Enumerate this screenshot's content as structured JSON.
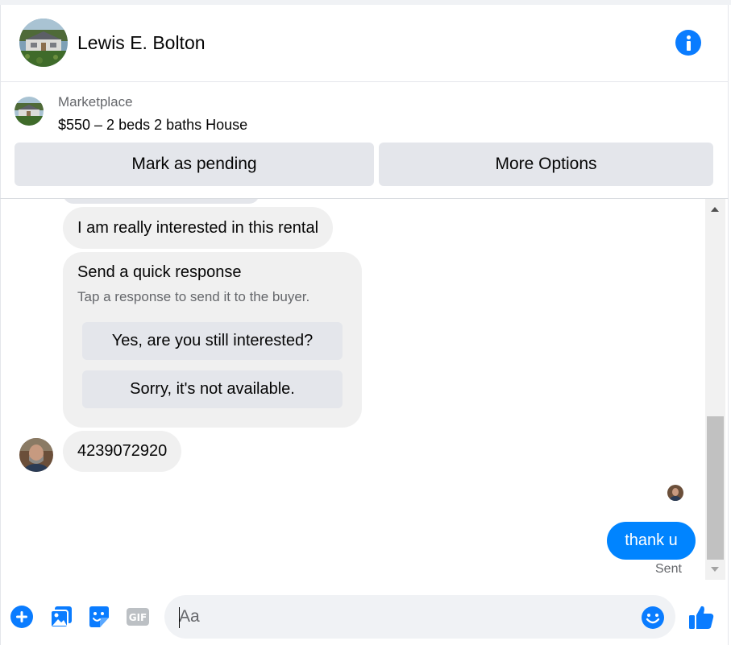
{
  "header": {
    "contact_name": "Lewis E. Bolton",
    "avatar_icon": "house-photo-icon",
    "info_icon": "info-icon"
  },
  "listing": {
    "source": "Marketplace",
    "title": "$550 – 2 beds 2 baths House",
    "thumbnail_icon": "house-photo-icon",
    "actions": {
      "mark_pending": "Mark as pending",
      "more_options": "More Options"
    }
  },
  "messages": {
    "incoming_1": "I am really interested in this rental",
    "quick_response": {
      "title": "Send a quick response",
      "subtitle": "Tap a response to send it to the buyer.",
      "options": [
        "Yes, are you still interested?",
        "Sorry, it's not available."
      ]
    },
    "incoming_2": "4239072920",
    "outgoing_1": "thank u",
    "outgoing_status": "Sent"
  },
  "composer": {
    "placeholder": "Aa",
    "value": "",
    "icons": [
      "plus-circle-icon",
      "photo-icon",
      "sticker-icon",
      "gif-icon",
      "emoji-icon",
      "thumbs-up-icon"
    ]
  },
  "colors": {
    "accent": "#0084ff",
    "icon_blue": "#0a7cff",
    "bubble_in": "#f0f0f0",
    "button_gray": "#e4e6eb",
    "secondary_text": "#65676b"
  }
}
